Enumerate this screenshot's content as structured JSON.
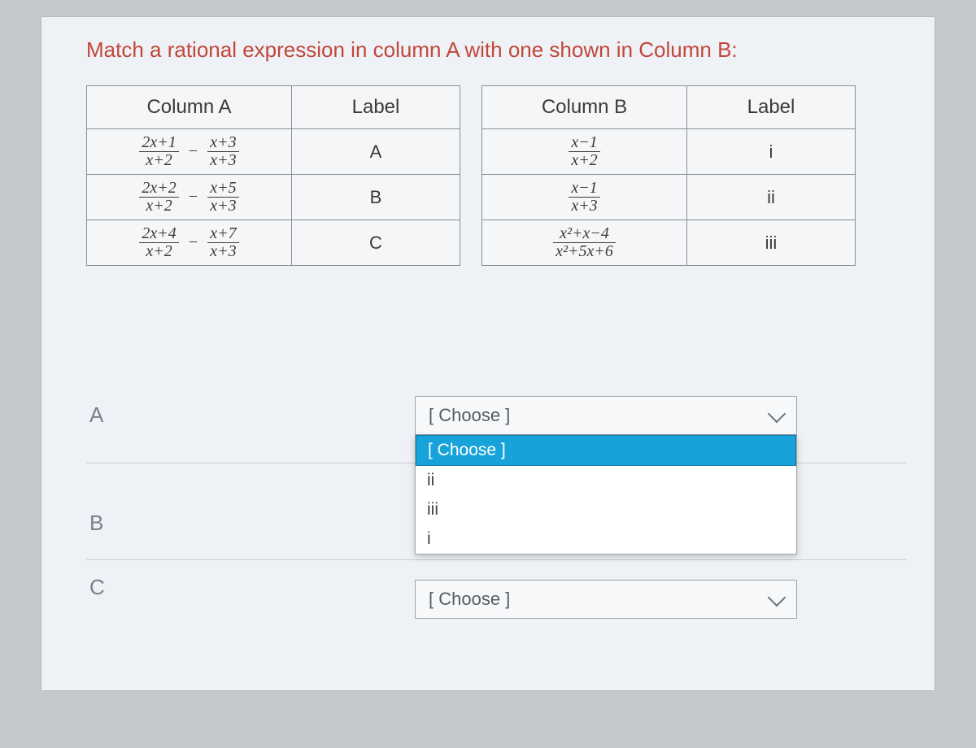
{
  "prompt": "Match a rational expression in column A with one shown in Column B:",
  "headers": {
    "colA": "Column A",
    "labA": "Label",
    "colB": "Column B",
    "labB": "Label"
  },
  "rows": [
    {
      "a_f1_num": "2x+1",
      "a_f1_den": "x+2",
      "a_f2_num": "x+3",
      "a_f2_den": "x+3",
      "labelA": "A",
      "b_num": "x−1",
      "b_den": "x+2",
      "labelB": "i"
    },
    {
      "a_f1_num": "2x+2",
      "a_f1_den": "x+2",
      "a_f2_num": "x+5",
      "a_f2_den": "x+3",
      "labelA": "B",
      "b_num": "x−1",
      "b_den": "x+3",
      "labelB": "ii"
    },
    {
      "a_f1_num": "2x+4",
      "a_f1_den": "x+2",
      "a_f2_num": "x+7",
      "a_f2_den": "x+3",
      "labelA": "C",
      "b_num": "x²+x−4",
      "b_den": "x²+5x+6",
      "labelB": "iii"
    }
  ],
  "minus": "−",
  "answers": {
    "items": [
      {
        "label": "A"
      },
      {
        "label": "B"
      },
      {
        "label": "C"
      }
    ],
    "placeholder": "[ Choose ]",
    "open_options": [
      "[ Choose ]",
      "ii",
      "iii",
      "i"
    ]
  }
}
